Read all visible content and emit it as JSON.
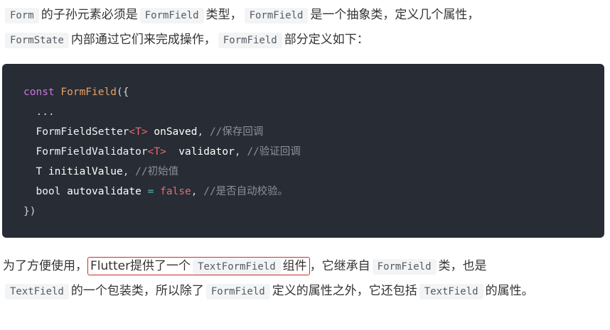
{
  "para1": {
    "code_form": "Form",
    "t1": "的子孙元素必须是",
    "code_formfield_a": "FormField",
    "t2": "类型，",
    "code_formfield_b": "FormField",
    "t3": "是一个抽象类，定义几个属性，",
    "code_formstate": "FormState",
    "t4": "内部通过它们来完成操作，",
    "code_formfield_c": "FormField",
    "t5": "部分定义如下："
  },
  "code": {
    "line1_kw": "const",
    "line1_cls": "FormField",
    "line1_punc": "({",
    "line2": "...",
    "line3_type": "FormFieldSetter",
    "line3_gen": "<T>",
    "line3_name": "onSaved",
    "line3_comment": "//保存回调",
    "line4_type": "FormFieldValidator",
    "line4_gen": "<T>",
    "line4_name": "validator",
    "line4_comment": "//验证回调",
    "line5_type": "T",
    "line5_name": "initialValue",
    "line5_comment": "//初始值",
    "line6_type": "bool",
    "line6_name": "autovalidate",
    "line6_op": "=",
    "line6_value": "false",
    "line6_comment": "//是否自动校验。",
    "line7": "})"
  },
  "para2": {
    "t1": "为了方便使用，",
    "highlight_text": "Flutter提供了一个",
    "code_textformfield": "TextFormField",
    "highlight_tail": "组件",
    "t2": "，它继承自",
    "code_formfield": "FormField",
    "t3": "类，也是",
    "code_textfield_a": "TextField",
    "t4": "的一个包装类，所以除了",
    "code_formfield_b": "FormField",
    "t5": "定义的属性之外，它还包括",
    "code_textfield_b": "TextField",
    "t6": "的属性。"
  }
}
